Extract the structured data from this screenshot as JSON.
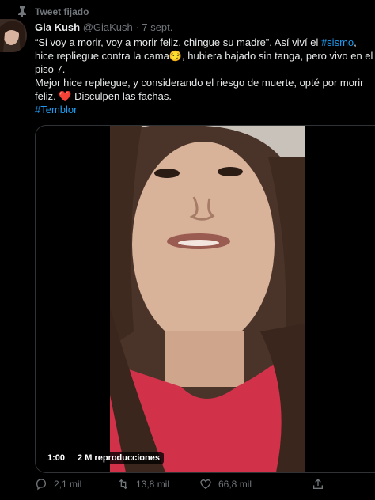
{
  "tweet": {
    "pinned_label": "Tweet fijado",
    "display_name": "Gia Kush",
    "handle": "@GiaKush",
    "separator": "·",
    "date": "7 sept.",
    "line1_a": "“Si voy a morir, voy a morir feliz, chingue su madre”. Así viví el ",
    "hashtag_sismo": "#sismo",
    "line1_b": ", hice repliegue contra la cama",
    "line1_c": ", hubiera bajado sin tanga, pero vivo en el piso 7.",
    "line2_a": "Mejor hice repliegue, y considerando el riesgo de muerte, opté por morir feliz.",
    "line2_b": " Disculpen las fachas.",
    "hashtag_temblor": "#Temblor",
    "emoji_smile": "😏",
    "emoji_heart": "❤️"
  },
  "video": {
    "duration": "1:00",
    "views": "2 M reproducciones"
  },
  "actions": {
    "replies": "2,1 mil",
    "retweets": "13,8 mil",
    "likes": "66,8 mil"
  },
  "icons": {
    "pin": "pin-icon",
    "reply": "reply-icon",
    "retweet": "retweet-icon",
    "like": "heart-icon",
    "share": "share-icon"
  },
  "colors": {
    "background": "#000000",
    "text": "#e7e9ea",
    "muted": "#71767b",
    "link": "#1d9bf0",
    "heart": "#e0245e"
  }
}
